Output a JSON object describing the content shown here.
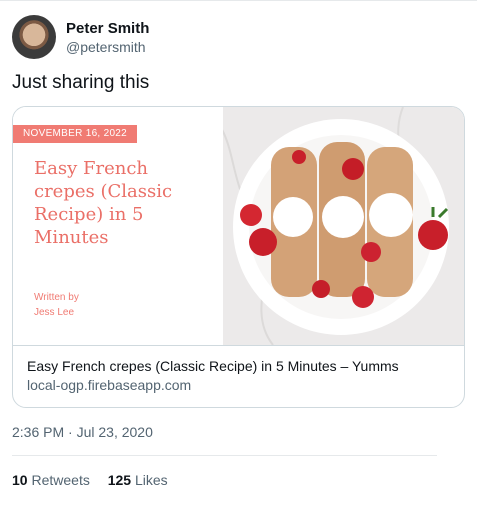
{
  "user": {
    "display_name": "Peter Smith",
    "handle": "@petersmith"
  },
  "tweet": {
    "text": "Just sharing this",
    "timestamp": "2:36 PM · Jul 23, 2020"
  },
  "card": {
    "image": {
      "date": "NOVEMBER 16, 2022",
      "title": "Easy French crepes (Classic Recipe) in 5 Minutes",
      "written_by": "Written by",
      "author": "Jess Lee"
    },
    "title": "Easy French crepes (Classic Recipe) in 5 Minutes – Yumms",
    "domain": "local-ogp.firebaseapp.com"
  },
  "stats": {
    "retweets_count": "10",
    "retweets_label": "Retweets",
    "likes_count": "125",
    "likes_label": "Likes"
  },
  "colors": {
    "accent": "#f07b73",
    "secondary_text": "#536471",
    "border": "#cfd9de"
  }
}
